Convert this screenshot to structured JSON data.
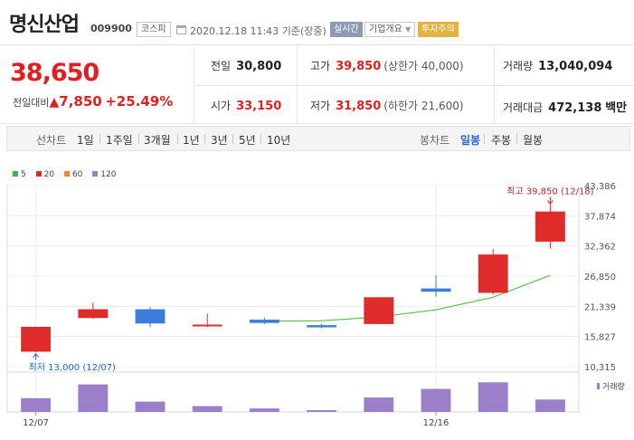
{
  "header": {
    "company": "명신산업",
    "code": "009900",
    "market": "코스피",
    "datetime": "2020.12.18 11:43",
    "basis": "기준(장중)",
    "realtime": "실시간",
    "overview": "기업개요",
    "overview_arrow": "▼",
    "warning": "투자주의"
  },
  "price": {
    "current": "38,650",
    "change_label": "전일대비",
    "change_icon": "▲",
    "change": "7,850",
    "change_rate": "+25.49%"
  },
  "stats": {
    "prev_close": {
      "label": "전일",
      "value": "30,800"
    },
    "high": {
      "label": "고가",
      "value": "39,850",
      "note": "(상한가 40,000)"
    },
    "volume": {
      "label": "거래량",
      "value": "13,040,094"
    },
    "open": {
      "label": "시가",
      "value": "33,150"
    },
    "low": {
      "label": "저가",
      "value": "31,850",
      "note": "(하한가 21,600)"
    },
    "amount": {
      "label": "거래대금",
      "value": "472,138",
      "unit": "백만"
    }
  },
  "toolbar": {
    "line_label": "선차트",
    "line_periods": [
      "1일",
      "1주일",
      "3개월",
      "1년",
      "3년",
      "5년",
      "10년"
    ],
    "candle_label": "봉차트",
    "candle_periods": [
      "일봉",
      "주봉",
      "월봉"
    ],
    "active_candle": "일봉"
  },
  "legend": [
    {
      "label": "5",
      "color": "#3db54a"
    },
    {
      "label": "20",
      "color": "#e02b2b"
    },
    {
      "label": "60",
      "color": "#f08a24"
    },
    {
      "label": "120",
      "color": "#9b7fc8"
    }
  ],
  "chart_data": {
    "type": "candlestick",
    "y_ticks": [
      "43,386",
      "37,874",
      "32,362",
      "26,850",
      "21,339",
      "15,827",
      "10,315"
    ],
    "ylim": [
      10315,
      43386
    ],
    "x_labels": [
      {
        "index": 0,
        "label": "12/07"
      },
      {
        "index": 7,
        "label": "12/16"
      }
    ],
    "candles": [
      {
        "open": 13050,
        "close": 17600,
        "high": 17600,
        "low": 13000
      },
      {
        "open": 19200,
        "close": 20800,
        "high": 22000,
        "low": 19000
      },
      {
        "open": 20800,
        "close": 18200,
        "high": 21200,
        "low": 17500
      },
      {
        "open": 17700,
        "close": 18000,
        "high": 20000,
        "low": 17500
      },
      {
        "open": 18900,
        "close": 18300,
        "high": 19300,
        "low": 18100
      },
      {
        "open": 17900,
        "close": 17500,
        "high": 18200,
        "low": 17300
      },
      {
        "open": 18100,
        "close": 23000,
        "high": 23000,
        "low": 18100
      },
      {
        "open": 24600,
        "close": 24000,
        "high": 27000,
        "low": 23100
      },
      {
        "open": 23800,
        "close": 30800,
        "high": 31800,
        "low": 23500
      },
      {
        "open": 33150,
        "close": 38650,
        "high": 39850,
        "low": 31850
      }
    ],
    "ma20": [
      null,
      null,
      null,
      null,
      18600,
      18700,
      19400,
      20700,
      23000,
      27000
    ],
    "volume_legend": "거래량",
    "volumes": [
      0.4,
      0.8,
      0.3,
      0.17,
      0.1,
      0.05,
      0.42,
      0.67,
      0.86,
      0.36
    ],
    "max_label": "최고 39,850 (12/18)",
    "min_label": "최저 13,000 (12/07)",
    "colors": {
      "up": "#e02b2b",
      "down": "#3a7ddb",
      "ma20": "#5cbf4a",
      "volume": "#9b7fc8",
      "grid": "#ececec",
      "annot_high": "#cc2222",
      "annot_low": "#2a63d6"
    }
  }
}
